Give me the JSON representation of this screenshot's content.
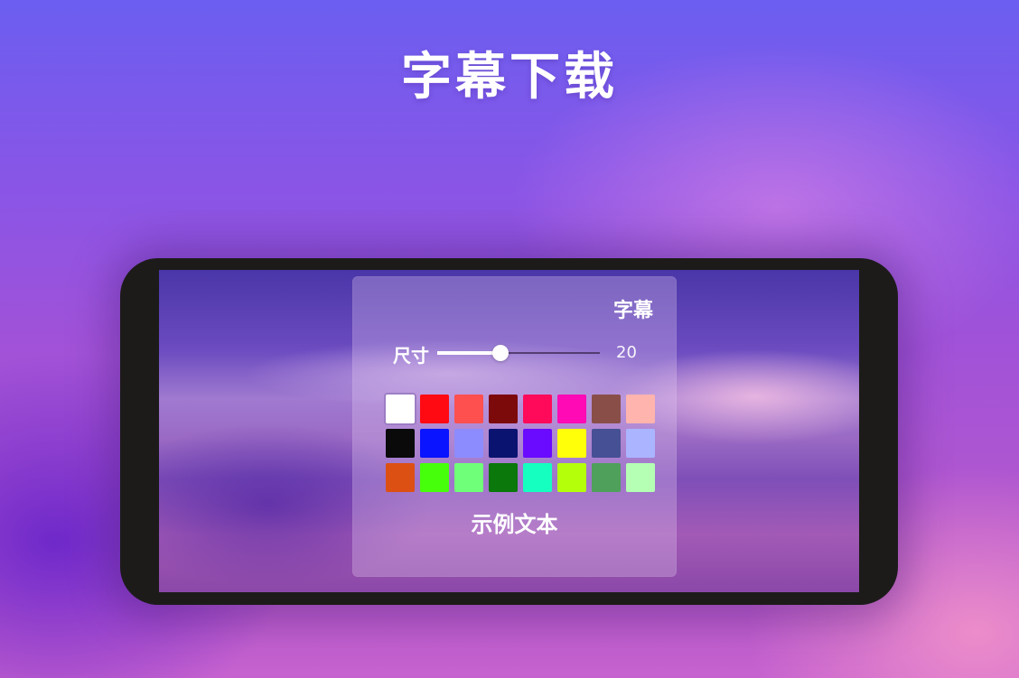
{
  "headline": "字幕下载",
  "subtitle_panel": {
    "title": "字幕",
    "size_label": "尺寸",
    "size_value": "20",
    "size_fraction": 0.39,
    "sample_text": "示例文本",
    "selected_color_index": 0,
    "colors": [
      "#ffffff",
      "#ff0a12",
      "#ff5050",
      "#7d0a0a",
      "#ff0a5a",
      "#ff0ab4",
      "#8a4e48",
      "#ffb4ad",
      "#0a0a0a",
      "#0a14ff",
      "#8c8cff",
      "#0a1470",
      "#6a0aff",
      "#ffff0a",
      "#465094",
      "#aab4ff",
      "#dc5014",
      "#46ff0a",
      "#70ff78",
      "#0a780a",
      "#14ffc0",
      "#b4ff0a",
      "#4ea05a",
      "#b4ffb4"
    ]
  }
}
